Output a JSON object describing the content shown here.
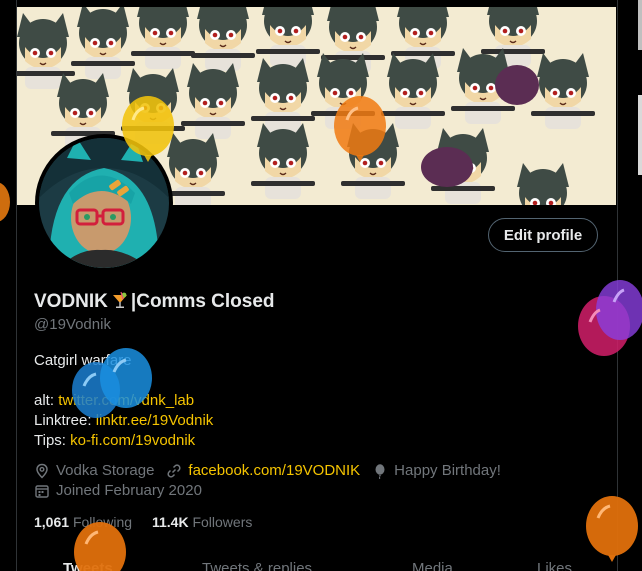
{
  "profile": {
    "display_name": "VODNIK",
    "display_name_suffix": "|Comms Closed",
    "handle": "@19Vodnik",
    "edit_button": "Edit profile",
    "bio_line1": "Catgirl warfare",
    "bio_alt_label": "alt: ",
    "bio_alt_link": "twitter.com/vdnk_lab",
    "bio_linktree_label": "Linktree: ",
    "bio_linktree_link": "linktr.ee/19Vodnik",
    "bio_tips_label": "Tips: ",
    "bio_tips_link": "ko-fi.com/19vodnik",
    "location": "Vodka Storage",
    "website": "facebook.com/19VODNIK",
    "birthday": "Happy Birthday!",
    "joined": "Joined February 2020",
    "following_count": "1,061",
    "following_label": "Following",
    "followers_count": "11.4K",
    "followers_label": "Followers"
  },
  "tabs": [
    "Tweets",
    "Tweets & replies",
    "Media",
    "Likes"
  ],
  "icons": {
    "location": "location-pin-icon",
    "website": "link-icon",
    "birthday": "balloon-icon",
    "joined": "calendar-icon",
    "drink": "tropical-drink-emoji-icon"
  },
  "colors": {
    "background": "#000000",
    "text": "#e7e9ea",
    "muted": "#71767b",
    "link": "#f5c400",
    "border": "#2f3336"
  }
}
